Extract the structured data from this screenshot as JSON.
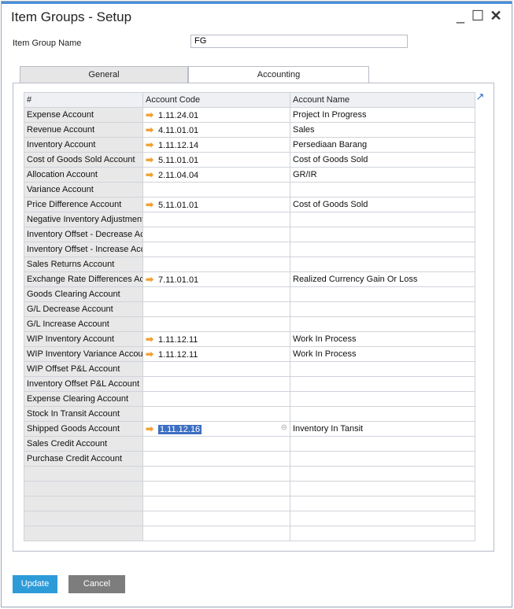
{
  "window": {
    "title": "Item Groups - Setup",
    "min": "_",
    "max": "☐",
    "close": "✕"
  },
  "form": {
    "item_group_name_label": "Item Group Name",
    "item_group_name_value": "FG"
  },
  "tabs": [
    {
      "label": "General"
    },
    {
      "label": "Accounting"
    }
  ],
  "grid": {
    "headers": [
      "#",
      "Account Code",
      "Account Name"
    ],
    "rows": [
      {
        "name": "Expense Account",
        "code": "1.11.24.01",
        "acc": "Project In Progress",
        "arrow": true
      },
      {
        "name": "Revenue Account",
        "code": "4.11.01.01",
        "acc": "Sales",
        "arrow": true
      },
      {
        "name": "Inventory Account",
        "code": "1.11.12.14",
        "acc": "Persediaan Barang",
        "arrow": true
      },
      {
        "name": "Cost of Goods Sold Account",
        "code": "5.11.01.01",
        "acc": "Cost of Goods Sold",
        "arrow": true
      },
      {
        "name": "Allocation Account",
        "code": "2.11.04.04",
        "acc": "GR/IR",
        "arrow": true
      },
      {
        "name": "Variance Account",
        "code": "",
        "acc": "",
        "arrow": false
      },
      {
        "name": "Price Difference Account",
        "code": "5.11.01.01",
        "acc": "Cost of Goods Sold",
        "arrow": true
      },
      {
        "name": "Negative Inventory Adjustment Account",
        "code": "",
        "acc": "",
        "arrow": false
      },
      {
        "name": "Inventory Offset - Decrease Account",
        "code": "",
        "acc": "",
        "arrow": false
      },
      {
        "name": "Inventory Offset - Increase Account",
        "code": "",
        "acc": "",
        "arrow": false
      },
      {
        "name": "Sales Returns Account",
        "code": "",
        "acc": "",
        "arrow": false
      },
      {
        "name": "Exchange Rate Differences Account",
        "code": "7.11.01.01",
        "acc": "Realized Currency Gain Or Loss",
        "arrow": true
      },
      {
        "name": "Goods Clearing Account",
        "code": "",
        "acc": "",
        "arrow": false
      },
      {
        "name": "G/L Decrease Account",
        "code": "",
        "acc": "",
        "arrow": false
      },
      {
        "name": "G/L Increase Account",
        "code": "",
        "acc": "",
        "arrow": false
      },
      {
        "name": "WIP Inventory Account",
        "code": "1.11.12.11",
        "acc": "Work In Process",
        "arrow": true
      },
      {
        "name": "WIP Inventory Variance Account",
        "code": "1.11.12.11",
        "acc": "Work In Process",
        "arrow": true
      },
      {
        "name": "WIP Offset P&L Account",
        "code": "",
        "acc": "",
        "arrow": false
      },
      {
        "name": "Inventory Offset P&L Account",
        "code": "",
        "acc": "",
        "arrow": false
      },
      {
        "name": "Expense Clearing Account",
        "code": "",
        "acc": "",
        "arrow": false
      },
      {
        "name": "Stock In Transit Account",
        "code": "",
        "acc": "",
        "arrow": false
      },
      {
        "name": "Shipped Goods Account",
        "code": "1.11.12.16",
        "acc": "Inventory In Tansit",
        "arrow": true,
        "selected": true
      },
      {
        "name": "Sales Credit Account",
        "code": "",
        "acc": "",
        "arrow": false
      },
      {
        "name": "Purchase Credit Account",
        "code": "",
        "acc": "",
        "arrow": false
      },
      {
        "name": "",
        "code": "",
        "acc": "",
        "arrow": false
      },
      {
        "name": "",
        "code": "",
        "acc": "",
        "arrow": false
      },
      {
        "name": "",
        "code": "",
        "acc": "",
        "arrow": false
      },
      {
        "name": "",
        "code": "",
        "acc": "",
        "arrow": false
      },
      {
        "name": "",
        "code": "",
        "acc": "",
        "arrow": false
      }
    ]
  },
  "buttons": {
    "update": "Update",
    "cancel": "Cancel"
  },
  "colors": {
    "accent": "#4a90d9",
    "update": "#2e9bd9",
    "cancel": "#7d7d7d",
    "selection": "#3c6fc2",
    "link_arrow": "#f0a030"
  }
}
